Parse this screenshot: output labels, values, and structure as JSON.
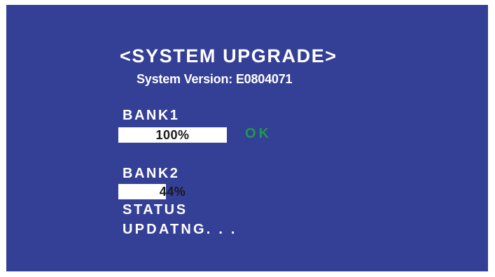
{
  "screen": {
    "title": "<SYSTEM UPGRADE>",
    "version_text": "System Version: E0804071",
    "background_color": "#343f96"
  },
  "banks": [
    {
      "label": "BANK1",
      "progress_percent": 100,
      "progress_text": "100%",
      "result": "OK",
      "result_color": "#1e9a4a"
    },
    {
      "label": "BANK2",
      "progress_percent": 44,
      "progress_text": "44%"
    }
  ],
  "status": {
    "label": "STATUS",
    "value": "UPDATNG. . ."
  }
}
